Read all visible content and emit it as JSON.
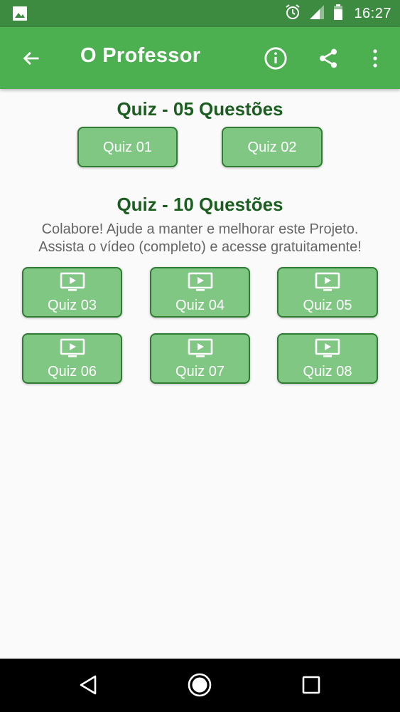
{
  "status_bar": {
    "time": "16:27",
    "icons": [
      "image-icon",
      "alarm-icon",
      "signal-icon",
      "battery-icon"
    ]
  },
  "app_bar": {
    "title": "O Professor",
    "actions": [
      "info-icon",
      "share-icon",
      "more-vert-icon"
    ],
    "color": "#4caf50"
  },
  "section1": {
    "title": "Quiz - 05 Questões",
    "buttons": [
      {
        "label": "Quiz 01"
      },
      {
        "label": "Quiz 02"
      }
    ]
  },
  "section2": {
    "title": "Quiz - 10 Questões",
    "subtitle_line1": "Colabore! Ajude a manter e melhorar este Projeto.",
    "subtitle_line2": "Assista o vídeo (completo) e acesse gratuitamente!",
    "buttons": [
      {
        "label": "Quiz 03",
        "icon": "video-icon"
      },
      {
        "label": "Quiz 04",
        "icon": "video-icon"
      },
      {
        "label": "Quiz 05",
        "icon": "video-icon"
      },
      {
        "label": "Quiz 06",
        "icon": "video-icon"
      },
      {
        "label": "Quiz 07",
        "icon": "video-icon"
      },
      {
        "label": "Quiz 08",
        "icon": "video-icon"
      }
    ]
  },
  "colors": {
    "status_bar": "#3d8b40",
    "button_fill": "#81c784",
    "button_border": "#2e7d32",
    "heading": "#1b5e20"
  }
}
